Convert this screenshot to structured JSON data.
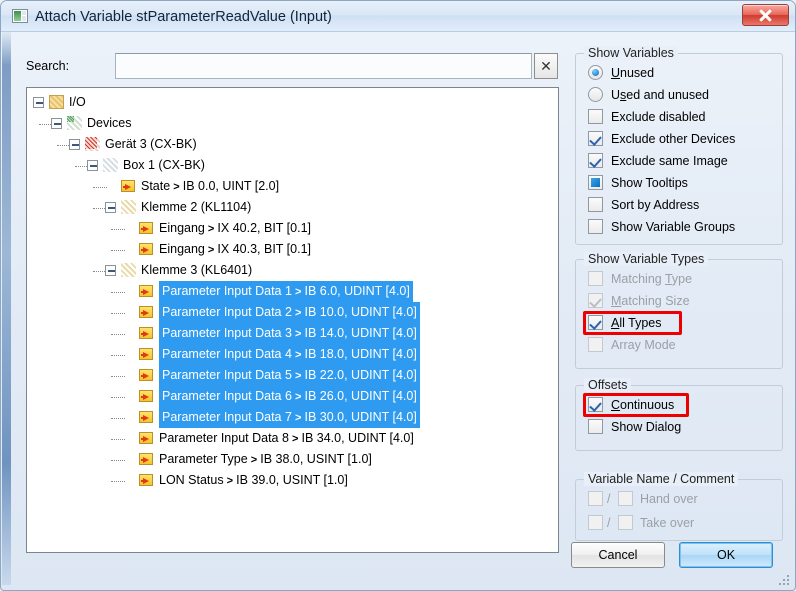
{
  "window": {
    "title": "Attach Variable stParameterReadValue (Input)",
    "icon": "window-icon",
    "close_label": "X"
  },
  "search": {
    "label": "Search:",
    "value": "",
    "placeholder": "",
    "clear_label": "✕"
  },
  "tree": [
    {
      "label": "I/O",
      "depth": 0,
      "icon": "folder-icon",
      "expander": "minus",
      "selected": false,
      "arrow": "",
      "address": ""
    },
    {
      "label": "Devices",
      "depth": 1,
      "icon": "devices-icon",
      "expander": "minus",
      "selected": false,
      "arrow": "",
      "address": ""
    },
    {
      "label": "Gerät 3 (CX-BK)",
      "depth": 2,
      "icon": "device-icon",
      "expander": "minus",
      "selected": false,
      "arrow": "",
      "address": ""
    },
    {
      "label": "Box 1 (CX-BK)",
      "depth": 3,
      "icon": "box-icon",
      "expander": "minus",
      "selected": false,
      "arrow": "",
      "address": ""
    },
    {
      "label": "State",
      "depth": 4,
      "icon": "variable-icon",
      "expander": "",
      "selected": false,
      "arrow": ">",
      "address": "IB 0.0, UINT [2.0]"
    },
    {
      "label": "Klemme 2 (KL1104)",
      "depth": 4,
      "icon": "terminal-icon",
      "expander": "minus",
      "selected": false,
      "arrow": "",
      "address": ""
    },
    {
      "label": "Eingang",
      "depth": 5,
      "icon": "variable-icon",
      "expander": "",
      "selected": false,
      "arrow": ">",
      "address": "IX 40.2, BIT [0.1]"
    },
    {
      "label": "Eingang",
      "depth": 5,
      "icon": "variable-icon",
      "expander": "",
      "selected": false,
      "arrow": ">",
      "address": "IX 40.3, BIT [0.1]"
    },
    {
      "label": "Klemme 3 (KL6401)",
      "depth": 4,
      "icon": "terminal-icon",
      "expander": "minus",
      "selected": false,
      "arrow": "",
      "address": ""
    },
    {
      "label": "Parameter Input Data 1",
      "depth": 5,
      "icon": "variable-icon",
      "expander": "",
      "selected": true,
      "arrow": ">",
      "address": "IB 6.0, UDINT [4.0]"
    },
    {
      "label": "Parameter Input Data 2",
      "depth": 5,
      "icon": "variable-icon",
      "expander": "",
      "selected": true,
      "arrow": ">",
      "address": "IB 10.0, UDINT [4.0]"
    },
    {
      "label": "Parameter Input Data 3",
      "depth": 5,
      "icon": "variable-icon",
      "expander": "",
      "selected": true,
      "arrow": ">",
      "address": "IB 14.0, UDINT [4.0]"
    },
    {
      "label": "Parameter Input Data 4",
      "depth": 5,
      "icon": "variable-icon",
      "expander": "",
      "selected": true,
      "arrow": ">",
      "address": "IB 18.0, UDINT [4.0]"
    },
    {
      "label": "Parameter Input Data 5",
      "depth": 5,
      "icon": "variable-icon",
      "expander": "",
      "selected": true,
      "arrow": ">",
      "address": "IB 22.0, UDINT [4.0]"
    },
    {
      "label": "Parameter Input Data 6",
      "depth": 5,
      "icon": "variable-icon",
      "expander": "",
      "selected": true,
      "arrow": ">",
      "address": "IB 26.0, UDINT [4.0]"
    },
    {
      "label": "Parameter Input Data 7",
      "depth": 5,
      "icon": "variable-icon",
      "expander": "",
      "selected": true,
      "arrow": ">",
      "address": "IB 30.0, UDINT [4.0]"
    },
    {
      "label": "Parameter Input Data 8",
      "depth": 5,
      "icon": "variable-icon",
      "expander": "",
      "selected": false,
      "arrow": ">",
      "address": "IB 34.0, UDINT [4.0]"
    },
    {
      "label": "Parameter Type",
      "depth": 5,
      "icon": "variable-icon",
      "expander": "",
      "selected": false,
      "arrow": ">",
      "address": "IB 38.0, USINT [1.0]"
    },
    {
      "label": "LON Status",
      "depth": 5,
      "icon": "variable-icon",
      "expander": "",
      "selected": false,
      "arrow": ">",
      "address": "IB 39.0, USINT [1.0]"
    }
  ],
  "show_variables": {
    "title": "Show Variables",
    "options": [
      {
        "label": "Unused",
        "type": "radio",
        "state": "checked",
        "disabled": false,
        "mnemonic": "U"
      },
      {
        "label": "Used and unused",
        "type": "radio",
        "state": "unchecked",
        "disabled": false,
        "mnemonic": "s"
      },
      {
        "label": "Exclude disabled",
        "type": "checkbox",
        "state": "unchecked",
        "disabled": false,
        "mnemonic": ""
      },
      {
        "label": "Exclude other Devices",
        "type": "checkbox",
        "state": "checked",
        "disabled": false,
        "mnemonic": ""
      },
      {
        "label": "Exclude same Image",
        "type": "checkbox",
        "state": "checked",
        "disabled": false,
        "mnemonic": "g"
      },
      {
        "label": "Show Tooltips",
        "type": "checkbox",
        "state": "filled",
        "disabled": false,
        "mnemonic": ""
      },
      {
        "label": "Sort by Address",
        "type": "checkbox",
        "state": "unchecked",
        "disabled": false,
        "mnemonic": ""
      },
      {
        "label": "Show Variable Groups",
        "type": "checkbox",
        "state": "unchecked",
        "disabled": false,
        "mnemonic": ""
      }
    ]
  },
  "show_variable_types": {
    "title": "Show Variable Types",
    "options": [
      {
        "label": "Matching Type",
        "type": "checkbox",
        "state": "unchecked",
        "disabled": true,
        "mnemonic": "T",
        "highlight": false
      },
      {
        "label": "Matching Size",
        "type": "checkbox",
        "state": "checked",
        "disabled": true,
        "mnemonic": "M",
        "highlight": false
      },
      {
        "label": "All Types",
        "type": "checkbox",
        "state": "checked",
        "disabled": false,
        "mnemonic": "A",
        "highlight": true
      },
      {
        "label": "Array Mode",
        "type": "checkbox",
        "state": "unchecked",
        "disabled": true,
        "mnemonic": "",
        "highlight": false
      }
    ]
  },
  "offsets": {
    "title": "Offsets",
    "options": [
      {
        "label": "Continuous",
        "type": "checkbox",
        "state": "checked",
        "disabled": false,
        "mnemonic": "C",
        "highlight": true
      },
      {
        "label": "Show Dialog",
        "type": "checkbox",
        "state": "unchecked",
        "disabled": false,
        "mnemonic": "",
        "highlight": false
      }
    ]
  },
  "variable_name_comment": {
    "title": "Variable Name / Comment",
    "rows": [
      {
        "separator": "/",
        "label": "Hand over",
        "left_state": "unchecked",
        "right_state": "unchecked",
        "disabled": true
      },
      {
        "separator": "/",
        "label": "Take over",
        "left_state": "unchecked",
        "right_state": "unchecked",
        "disabled": true
      }
    ]
  },
  "buttons": {
    "cancel": "Cancel",
    "ok": "OK"
  },
  "colors": {
    "selection_blue": "#2e9bf0",
    "annotation_red": "#ee0000",
    "accent": "#2c8fd6"
  }
}
